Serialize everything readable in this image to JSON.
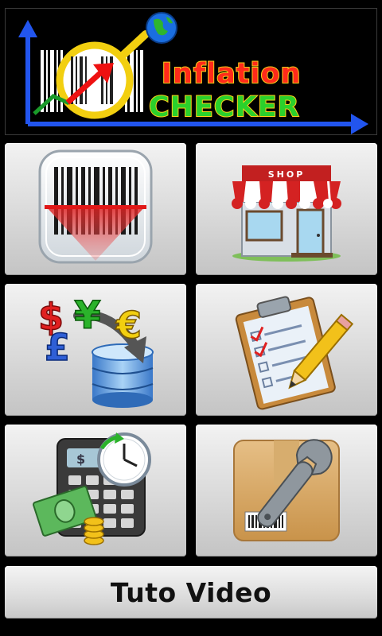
{
  "app": {
    "logo": {
      "line1": "Inflation",
      "line2": "CHECKER"
    }
  },
  "menu": [
    {
      "name": "barcode-scanner",
      "icon": "barcode-scan-icon"
    },
    {
      "name": "shop",
      "icon": "shop-icon",
      "sign_text": "SHOP"
    },
    {
      "name": "currency-database",
      "icon": "currency-database-icon",
      "symbols": [
        "$",
        "¥",
        "€",
        "£"
      ]
    },
    {
      "name": "checklist",
      "icon": "clipboard-pencil-icon"
    },
    {
      "name": "calculator-cash",
      "icon": "calculator-money-icon",
      "display_symbol": "$"
    },
    {
      "name": "tools-package",
      "icon": "wrench-box-icon"
    }
  ],
  "tuto_button": {
    "label": "Tuto Video"
  }
}
